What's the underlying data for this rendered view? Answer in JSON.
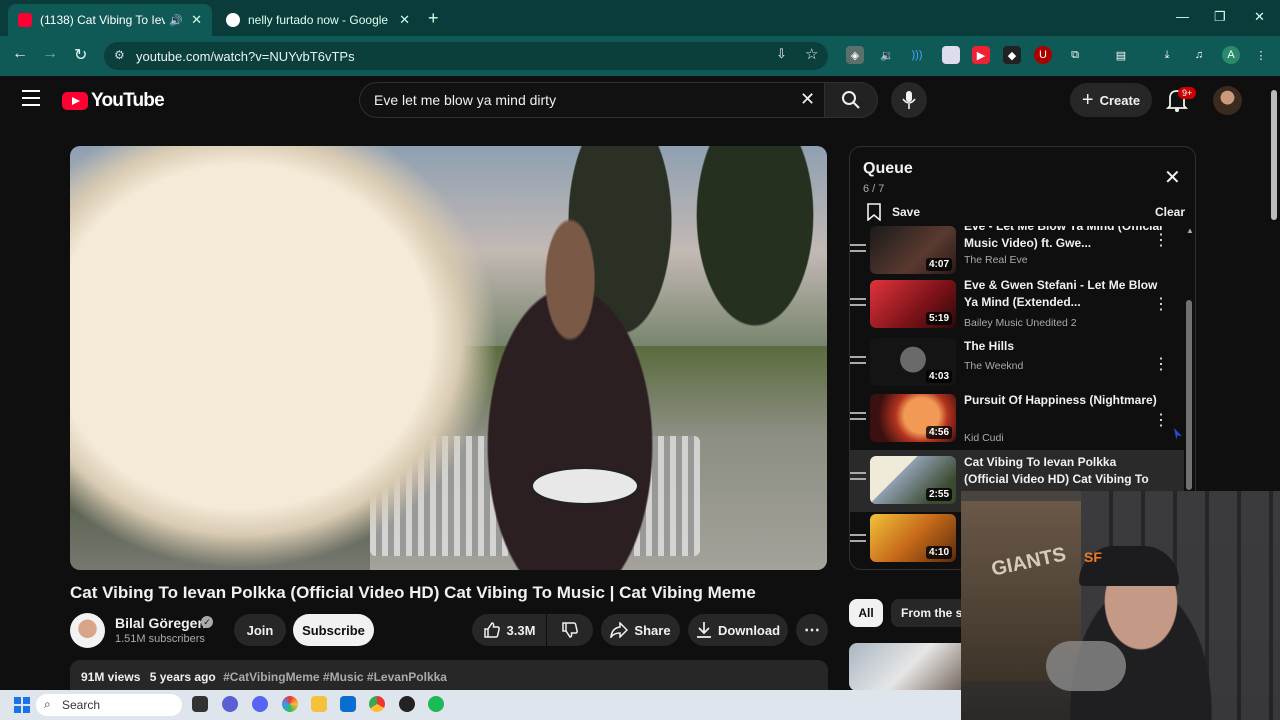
{
  "browser": {
    "tabs": [
      {
        "title": "(1138) Cat Vibing To Ievan Polkka",
        "active": true
      },
      {
        "title": "nelly furtado now - Google Search",
        "active": false
      }
    ],
    "url": "youtube.com/watch?v=NUYvbT6vTPs"
  },
  "yt_header": {
    "logo": "YouTube",
    "search_value": "Eve let me blow ya mind dirty",
    "create_label": "Create",
    "notification_badge": "9+"
  },
  "video": {
    "title": "Cat Vibing To Ievan Polkka (Official Video HD) Cat Vibing To Music | Cat Vibing Meme",
    "channel": "Bilal Göregen",
    "subscribers": "1.51M subscribers",
    "join_label": "Join",
    "subscribe_label": "Subscribe",
    "likes": "3.3M",
    "share_label": "Share",
    "download_label": "Download",
    "views": "91M views",
    "age": "5 years ago",
    "tags": "#CatVibingMeme #Music #LevanPolkka"
  },
  "queue": {
    "title": "Queue",
    "position": "6 / 7",
    "save_label": "Save",
    "clear_label": "Clear",
    "items": [
      {
        "title": "Eve - Let Me Blow Ya Mind (Official Music Video) ft. Gwe...",
        "channel": "The Real Eve",
        "duration": "4:07",
        "thumb": "#3a2a2a"
      },
      {
        "title": "Eve & Gwen Stefani - Let Me Blow Ya Mind (Extended...",
        "channel": "Bailey Music Unedited 2",
        "duration": "5:19",
        "thumb": "#b3222a"
      },
      {
        "title": "The Hills",
        "channel": "The Weeknd",
        "duration": "4:03",
        "thumb": "#1c1c1c"
      },
      {
        "title": "Pursuit Of Happiness (Nightmare)",
        "channel": "Kid Cudi",
        "duration": "4:56",
        "thumb": "#e0592c"
      },
      {
        "title": "Cat Vibing To Ievan Polkka (Official Video HD) Cat Vibing To Music | Cat...",
        "channel": "",
        "duration": "2:55",
        "thumb": "#8a9aa8"
      },
      {
        "title": "",
        "channel": "",
        "duration": "4:10",
        "thumb": "#d99a1c"
      }
    ]
  },
  "chips": {
    "all": "All",
    "second": "From the se"
  },
  "taskbar": {
    "search": "Search"
  },
  "colors": {
    "accent": "#ff0033",
    "chrome_tab": "#0f5a57"
  }
}
